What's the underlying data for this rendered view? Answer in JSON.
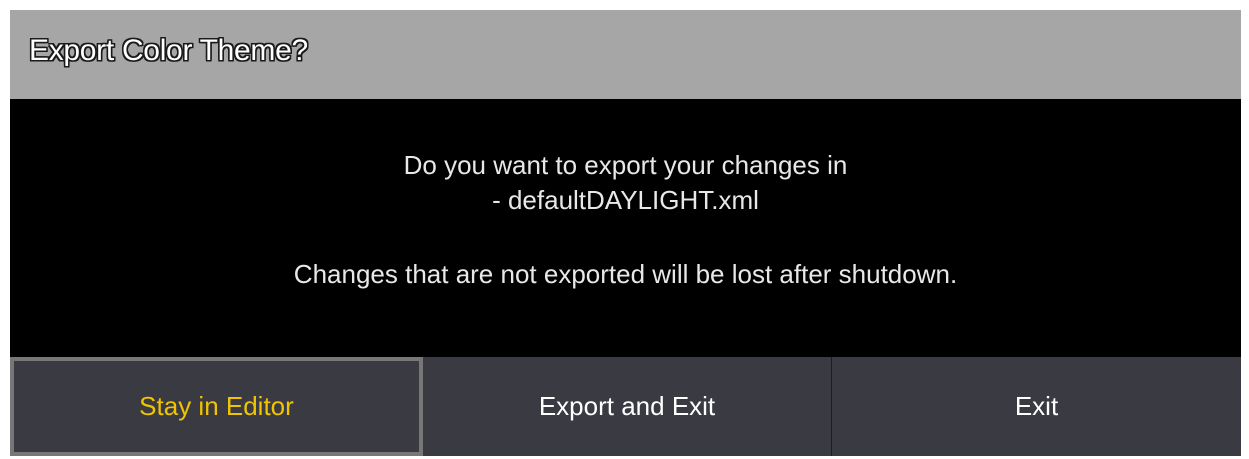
{
  "dialog": {
    "title": "Export Color Theme?",
    "message": {
      "line1": "Do you want to export your changes in",
      "line2": "- defaultDAYLIGHT.xml",
      "line3": "Changes that are not exported will be lost after shutdown."
    },
    "buttons": {
      "stay_label": "Stay in Editor",
      "export_label": "Export and Exit",
      "exit_label": "Exit"
    }
  },
  "colors": {
    "title_bar": "#a6a6a6",
    "message_bg": "#000000",
    "button_bg": "#3a3a42",
    "focused_button_text": "#f0c400",
    "focus_border": "#777777"
  }
}
